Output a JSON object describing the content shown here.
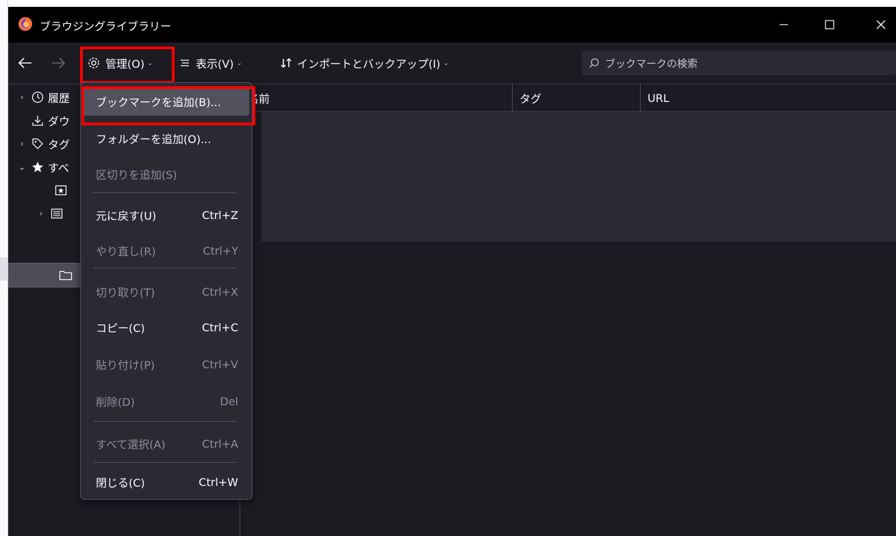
{
  "window": {
    "title": "ブラウジングライブラリー"
  },
  "toolbar": {
    "manage_label": "管理(O)",
    "view_label": "表示(V)",
    "import_label": "インポートとバックアップ(I)",
    "search_placeholder": "ブックマークの検索"
  },
  "tree": {
    "items": [
      {
        "label": "履歴",
        "icon": "clock-icon"
      },
      {
        "label": "ダウ",
        "icon": "download-icon"
      },
      {
        "label": "タグ",
        "icon": "tag-icon"
      },
      {
        "label": "すべ",
        "icon": "star-icon"
      },
      {
        "label": "",
        "icon": "bookmark-toolbar-icon"
      },
      {
        "label": "",
        "icon": "bookmark-menu-icon"
      },
      {
        "label": "",
        "icon": "folder-icon"
      }
    ]
  },
  "columns": {
    "name": "名前",
    "tag": "タグ",
    "url": "URL"
  },
  "menu": {
    "items": [
      {
        "label": "ブックマークを追加(B)...",
        "shortcut": ""
      },
      {
        "label": "フォルダーを追加(O)...",
        "shortcut": ""
      },
      {
        "label": "区切りを追加(S)",
        "shortcut": ""
      },
      {
        "label": "元に戻す(U)",
        "shortcut": "Ctrl+Z"
      },
      {
        "label": "やり直し(R)",
        "shortcut": "Ctrl+Y"
      },
      {
        "label": "切り取り(T)",
        "shortcut": "Ctrl+X"
      },
      {
        "label": "コピー(C)",
        "shortcut": "Ctrl+C"
      },
      {
        "label": "貼り付け(P)",
        "shortcut": "Ctrl+V"
      },
      {
        "label": "削除(D)",
        "shortcut": "Del"
      },
      {
        "label": "すべて選択(A)",
        "shortcut": "Ctrl+A"
      },
      {
        "label": "閉じる(C)",
        "shortcut": "Ctrl+W"
      }
    ]
  },
  "colors": {
    "highlight": "#ff0000",
    "background": "#1c1b22",
    "menu": "#2b2a33"
  }
}
